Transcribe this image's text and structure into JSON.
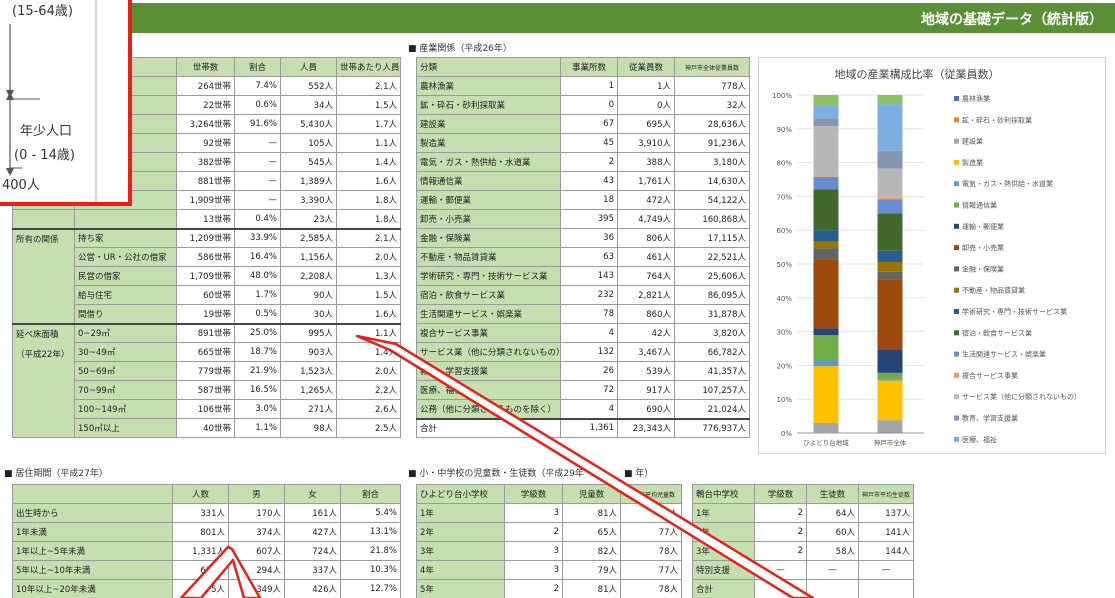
{
  "header": {
    "title": "地域の基礎データ（統計版）"
  },
  "household": {
    "columns": [
      "世帯数",
      "割合",
      "人員",
      "世帯あたり人員"
    ],
    "rows_top": [
      [
        "264世帯",
        "7.4%",
        "552人",
        "2.1人"
      ],
      [
        "22世帯",
        "0.6%",
        "34人",
        "1.5人"
      ],
      [
        "3,264世帯",
        "91.6%",
        "5,430人",
        "1.7人"
      ],
      [
        "92世帯",
        "—",
        "105人",
        "1.1人"
      ],
      [
        "382世帯",
        "—",
        "545人",
        "1.4人"
      ],
      [
        "881世帯",
        "—",
        "1,389人",
        "1.6人"
      ],
      [
        "1,909世帯",
        "—",
        "3,390人",
        "1.8人"
      ],
      [
        "13世帯",
        "0.4%",
        "23人",
        "1.8人"
      ]
    ],
    "ownership_label": "所有の関係",
    "ownership": [
      [
        "持ち家",
        "1,209世帯",
        "33.9%",
        "2,585人",
        "2.1人"
      ],
      [
        "公営・UR・公社の借家",
        "586世帯",
        "16.4%",
        "1,156人",
        "2.0人"
      ],
      [
        "民営の借家",
        "1,709世帯",
        "48.0%",
        "2,208人",
        "1.3人"
      ],
      [
        "給与住宅",
        "60世帯",
        "1.7%",
        "90人",
        "1.5人"
      ],
      [
        "間借り",
        "19世帯",
        "0.5%",
        "30人",
        "1.6人"
      ]
    ],
    "floor_label": "延べ床面積",
    "floor_sub": "（平成22年）",
    "floor": [
      [
        "0~29㎡",
        "891世帯",
        "25.0%",
        "995人",
        "1.1人"
      ],
      [
        "30~49㎡",
        "665世帯",
        "18.7%",
        "903人",
        "1.4人"
      ],
      [
        "50~69㎡",
        "779世帯",
        "21.9%",
        "1,523人",
        "2.0人"
      ],
      [
        "70~99㎡",
        "587世帯",
        "16.5%",
        "1,265人",
        "2.2人"
      ],
      [
        "100~149㎡",
        "106世帯",
        "3.0%",
        "271人",
        "2.6人"
      ],
      [
        "150㎡以上",
        "40世帯",
        "1.1%",
        "98人",
        "2.5人"
      ]
    ]
  },
  "industry": {
    "section": "産業関係（平成26年）",
    "columns": [
      "分類",
      "事業所数",
      "従業員数",
      "神戸市全体従業員数"
    ],
    "rows": [
      [
        "農林漁業",
        "1",
        "1人",
        "778人"
      ],
      [
        "鉱・砕石・砂利採取業",
        "0",
        "0人",
        "32人"
      ],
      [
        "建設業",
        "67",
        "695人",
        "28,636人"
      ],
      [
        "製造業",
        "45",
        "3,910人",
        "91,236人"
      ],
      [
        "電気・ガス・熱供給・水道業",
        "2",
        "388人",
        "3,180人"
      ],
      [
        "情報通信業",
        "43",
        "1,761人",
        "14,630人"
      ],
      [
        "運輸・郵便業",
        "18",
        "472人",
        "54,122人"
      ],
      [
        "卸売・小売業",
        "395",
        "4,749人",
        "160,868人"
      ],
      [
        "金融・保険業",
        "36",
        "806人",
        "17,115人"
      ],
      [
        "不動産・物品賃貸業",
        "63",
        "461人",
        "22,521人"
      ],
      [
        "学術研究・専門・技術サービス業",
        "143",
        "764人",
        "25,606人"
      ],
      [
        "宿泊・飲食サービス業",
        "232",
        "2,821人",
        "86,095人"
      ],
      [
        "生活関連サービス・娯楽業",
        "78",
        "860人",
        "31,878人"
      ],
      [
        "複合サービス事業",
        "4",
        "42人",
        "3,820人"
      ],
      [
        "サービス業（他に分類されないもの）",
        "132",
        "3,467人",
        "66,782人"
      ],
      [
        "教育、学習支援業",
        "26",
        "539人",
        "41,357人"
      ],
      [
        "医療、福祉",
        "72",
        "917人",
        "107,257人"
      ],
      [
        "公務（他に分類されるものを除く）",
        "4",
        "690人",
        "21,024人"
      ]
    ],
    "total": [
      "合計",
      "1,361",
      "23,343人",
      "776,937人"
    ]
  },
  "residence": {
    "section": "居住期間（平成27年）",
    "columns": [
      "人数",
      "男",
      "女",
      "割合"
    ],
    "rows": [
      [
        "出生時から",
        "331人",
        "170人",
        "161人",
        "5.4%"
      ],
      [
        "1年未満",
        "801人",
        "374人",
        "427人",
        "13.1%"
      ],
      [
        "1年以上~5年未満",
        "1,331人",
        "607人",
        "724人",
        "21.8%"
      ],
      [
        "5年以上~10年未満",
        "631人",
        "294人",
        "337人",
        "10.3%"
      ],
      [
        "10年以上~20年未満",
        "775人",
        "349人",
        "426人",
        "12.7%"
      ]
    ]
  },
  "school": {
    "section": "小・中学校の児童数・生徒数（平成29年",
    "section_tail": "年）",
    "elementary_name": "ひよどり台小学校",
    "elementary_cols": [
      "学級数",
      "児童数",
      "神戸市平均児童数"
    ],
    "elementary": [
      [
        "1年",
        "3",
        "81人",
        "79人"
      ],
      [
        "2年",
        "2",
        "65人",
        "77人"
      ],
      [
        "3年",
        "3",
        "82人",
        "78人"
      ],
      [
        "4年",
        "3",
        "79人",
        "77人"
      ],
      [
        "5年",
        "2",
        "81人",
        "78人"
      ]
    ],
    "middle_name": "鵯台中学校",
    "middle_cols": [
      "学級数",
      "生徒数",
      "神戸市平均生徒数"
    ],
    "middle": [
      [
        "1年",
        "2",
        "64人",
        "137人"
      ],
      [
        "2年",
        "2",
        "60人",
        "141人"
      ],
      [
        "3年",
        "2",
        "58人",
        "144人"
      ],
      [
        "特別支援",
        "—",
        "—",
        "—"
      ],
      [
        "合計",
        "",
        "",
        ""
      ]
    ]
  },
  "chart_data": {
    "type": "bar",
    "stacked": true,
    "percent": true,
    "title": "地域の産業構成比率（従業員数）",
    "categories": [
      "ひよどり台地域",
      "神戸市全体"
    ],
    "ylim": [
      0,
      100
    ],
    "yticks": [
      "0%",
      "10%",
      "20%",
      "30%",
      "40%",
      "50%",
      "60%",
      "70%",
      "80%",
      "90%",
      "100%"
    ],
    "legend_position": "right",
    "series": [
      {
        "name": "農林漁業",
        "color": "#4472c4",
        "values": [
          0.0,
          0.1
        ]
      },
      {
        "name": "鉱・砕石・砂利採取業",
        "color": "#ed7d31",
        "values": [
          0.0,
          0.0
        ]
      },
      {
        "name": "建設業",
        "color": "#a5a5a5",
        "values": [
          3.0,
          3.7
        ]
      },
      {
        "name": "製造業",
        "color": "#ffc000",
        "values": [
          16.8,
          11.7
        ]
      },
      {
        "name": "電気・ガス・熱供給・水道業",
        "color": "#5b9bd5",
        "values": [
          1.7,
          0.4
        ]
      },
      {
        "name": "情報通信業",
        "color": "#70ad47",
        "values": [
          7.5,
          1.9
        ]
      },
      {
        "name": "運輸・郵便業",
        "color": "#264478",
        "values": [
          2.0,
          7.0
        ]
      },
      {
        "name": "卸売・小売業",
        "color": "#9e480e",
        "values": [
          20.3,
          20.7
        ]
      },
      {
        "name": "金融・保険業",
        "color": "#636363",
        "values": [
          3.5,
          2.2
        ]
      },
      {
        "name": "不動産・物品賃貸業",
        "color": "#997300",
        "values": [
          2.0,
          2.9
        ]
      },
      {
        "name": "学術研究・専門・技術サービス業",
        "color": "#255e91",
        "values": [
          3.3,
          3.3
        ]
      },
      {
        "name": "宿泊・飲食サービス業",
        "color": "#43682b",
        "values": [
          12.1,
          11.1
        ]
      },
      {
        "name": "生活関連サービス・娯楽業",
        "color": "#698ed0",
        "values": [
          3.7,
          4.1
        ]
      },
      {
        "name": "複合サービス事業",
        "color": "#f1975a",
        "values": [
          0.2,
          0.5
        ]
      },
      {
        "name": "サービス業（他に分類されないもの）",
        "color": "#b7b7b7",
        "values": [
          14.9,
          8.6
        ]
      },
      {
        "name": "教育、学習支援業",
        "color": "#8497b0",
        "values": [
          2.3,
          5.3
        ]
      },
      {
        "name": "医療、福祉",
        "color": "#7cafdd",
        "values": [
          3.9,
          13.8
        ]
      },
      {
        "name": "公務（他に分類されるものを除く）",
        "color": "#8cc168",
        "values": [
          3.0,
          2.7
        ]
      }
    ]
  },
  "zoom_inset": {
    "line1": "(15-64歳)",
    "line2": "年少人口",
    "line3": "(0 - 14歳)",
    "line4": "400人"
  },
  "colors": {
    "header": "#5b8f36",
    "cell_green": "#c5dfb1",
    "callout": "#e8201a"
  }
}
